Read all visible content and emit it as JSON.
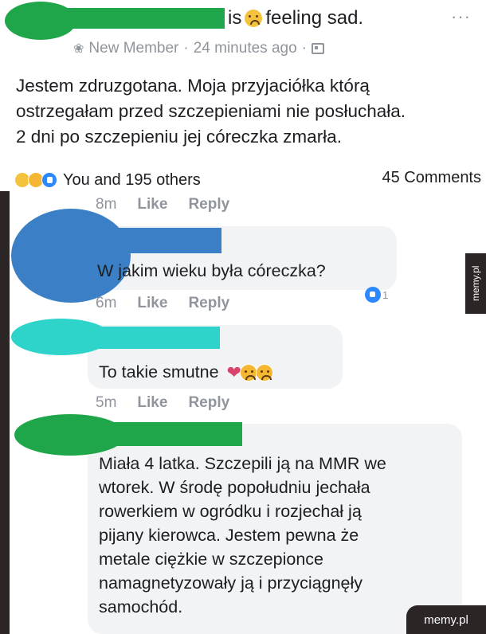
{
  "post": {
    "feeling_prefix": "is",
    "feeling_text": "feeling sad.",
    "more_label": "···",
    "member_label": "New Member",
    "separator1": "·",
    "time_ago": "24 minutes ago",
    "separator2": "·",
    "body_lines": [
      "Jestem zdruzgotana. Moja przyjaciółka którą",
      "ostrzegałam przed szczepieniami nie posłuchała.",
      "2 dni po szczepieniu jej córeczka zmarła."
    ],
    "reactions_summary": "You and 195 others",
    "comments_count": "45 Comments"
  },
  "comments": [
    {
      "time": "8m",
      "like": "Like",
      "reply": "Reply"
    },
    {
      "text": "W jakim wieku była córeczka?",
      "time": "6m",
      "like": "Like",
      "reply": "Reply",
      "reaction_count": "1"
    },
    {
      "text": "To takie smutne",
      "time": "5m",
      "like": "Like",
      "reply": "Reply"
    },
    {
      "lines": [
        "Miała 4 latka. Szczepili ją na MMR we",
        "wtorek. W środę popołudniu jechała",
        "rowerkiem w ogródku i rozjechał ją",
        "pijany kierowca. Jestem pewna że",
        "metale ciężkie w szczepionce",
        "namagnetyzowały ją i przyciągnęły",
        "samochód."
      ]
    }
  ],
  "watermarks": {
    "side": "memy.pl",
    "corner": "memy.pl"
  },
  "colors": {
    "redact_green": "#1fa64a",
    "redact_blue": "#3b80c6",
    "redact_cyan": "#2ed3c9",
    "facebook_blue": "#2d88ff",
    "bubble_gray": "#f2f3f5"
  }
}
